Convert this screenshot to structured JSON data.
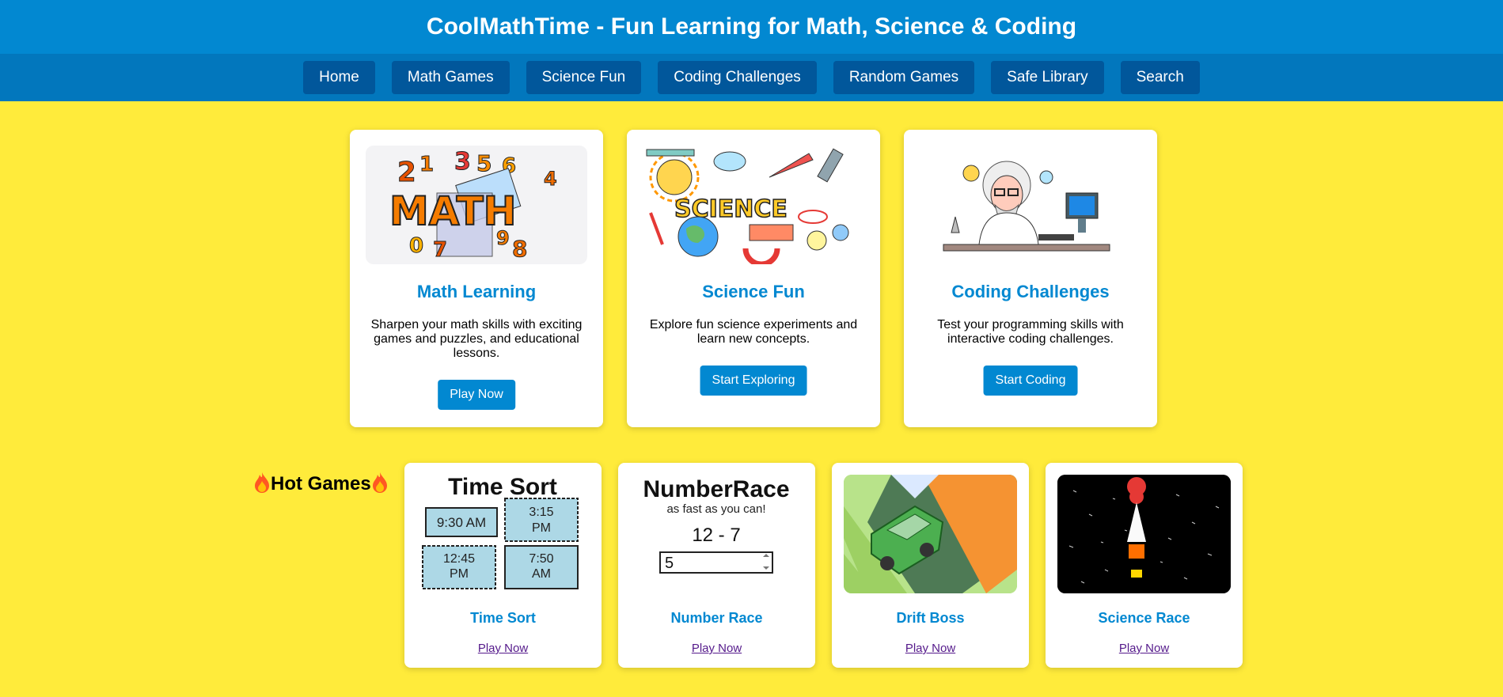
{
  "site": {
    "title": "CoolMathTime - Fun Learning for Math, Science & Coding"
  },
  "nav": [
    "Home",
    "Math Games",
    "Science Fun",
    "Coding Challenges",
    "Random Games",
    "Safe Library",
    "Search"
  ],
  "cards": [
    {
      "title": "Math Learning",
      "description": "Sharpen your math skills with exciting games and puzzles, and educational lessons.",
      "button": "Play Now",
      "image_text": "MATH"
    },
    {
      "title": "Science Fun",
      "description": "Explore fun science experiments and learn new concepts.",
      "button": "Start Exploring",
      "image_text": "SCIENCE"
    },
    {
      "title": "Coding Challenges",
      "description": "Test your programming skills with interactive coding challenges.",
      "button": "Start Coding"
    }
  ],
  "hot_games": {
    "title": "Hot Games",
    "games": [
      {
        "title": "Time Sort",
        "link": "Play Now",
        "image": {
          "heading": "Time Sort",
          "times": [
            "9:30 AM",
            "3:15 PM",
            "12:45 PM",
            "7:50 AM"
          ]
        }
      },
      {
        "title": "Number Race",
        "link": "Play Now",
        "image": {
          "heading": "NumberRace",
          "subheading": "as fast as you can!",
          "problem": "12 - 7",
          "answer": "5"
        }
      },
      {
        "title": "Drift Boss",
        "link": "Play Now"
      },
      {
        "title": "Science Race",
        "link": "Play Now"
      }
    ]
  },
  "colors": {
    "header": "#0288d1",
    "nav": "#0277bd",
    "nav_button": "#01579b",
    "background": "#ffeb3b",
    "accent": "#0288d1",
    "link": "#551a8b"
  }
}
